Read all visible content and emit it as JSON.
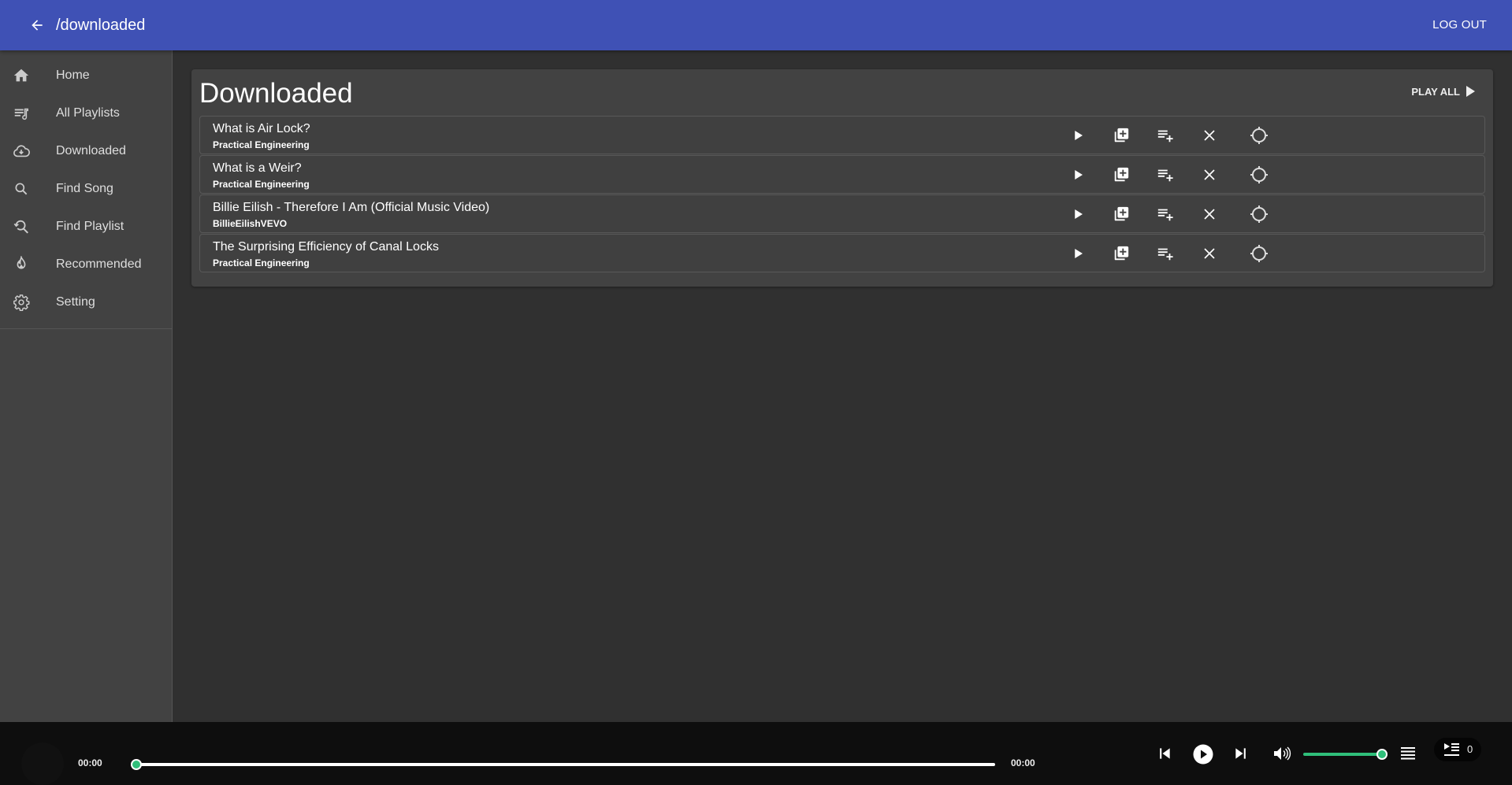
{
  "appbar": {
    "title": "/downloaded",
    "back_icon": "arrow-left-icon",
    "logout_label": "LOG OUT",
    "color": "#3f51b5"
  },
  "sidebar": {
    "items": [
      {
        "label": "Home",
        "icon": "home-icon"
      },
      {
        "label": "All Playlists",
        "icon": "playlist-music-icon"
      },
      {
        "label": "Downloaded",
        "icon": "cloud-download-icon"
      },
      {
        "label": "Find Song",
        "icon": "search-icon"
      },
      {
        "label": "Find Playlist",
        "icon": "search-history-icon"
      },
      {
        "label": "Recommended",
        "icon": "fire-icon"
      },
      {
        "label": "Setting",
        "icon": "gear-icon"
      }
    ]
  },
  "main": {
    "title": "Downloaded",
    "play_all_label": "PLAY ALL",
    "songs": [
      {
        "title": "What is Air Lock?",
        "channel": "Practical Engineering"
      },
      {
        "title": "What is a Weir?",
        "channel": "Practical Engineering"
      },
      {
        "title": "Billie Eilish - Therefore I Am (Official Music Video)",
        "channel": "BillieEilishVEVO"
      },
      {
        "title": "The Surprising Efficiency of Canal Locks",
        "channel": "Practical Engineering"
      }
    ],
    "row_actions": [
      "play-icon",
      "library-add-icon",
      "playlist-add-icon",
      "close-icon",
      "locate-icon"
    ]
  },
  "player": {
    "current_time": "00:00",
    "duration": "00:00",
    "progress": 0,
    "volume": 1.0,
    "queue_count": "0",
    "accent_color": "#2fbf7a"
  }
}
